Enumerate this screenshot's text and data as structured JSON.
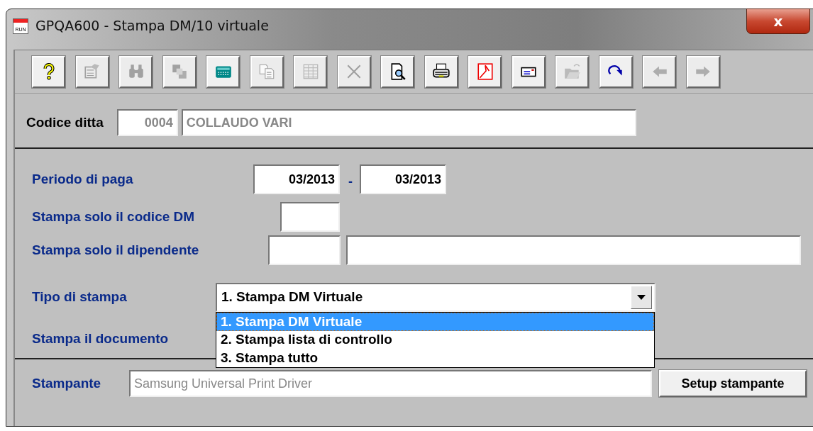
{
  "window": {
    "title": "GPQA600 - Stampa DM/10 virtuale",
    "app_icon_text": "RUN",
    "close": "x"
  },
  "toolbar": [
    {
      "kind": "help",
      "disabled": false
    },
    {
      "kind": "properties",
      "disabled": true
    },
    {
      "kind": "binoculars",
      "disabled": true
    },
    {
      "kind": "squares",
      "disabled": true
    },
    {
      "kind": "calculator",
      "disabled": false
    },
    {
      "kind": "copy",
      "disabled": true
    },
    {
      "kind": "grid",
      "disabled": true
    },
    {
      "kind": "delete",
      "disabled": true
    },
    {
      "kind": "preview",
      "disabled": false
    },
    {
      "kind": "print",
      "disabled": false
    },
    {
      "kind": "pdf",
      "disabled": false
    },
    {
      "kind": "mail",
      "disabled": false
    },
    {
      "kind": "folder",
      "disabled": true
    },
    {
      "kind": "redo",
      "disabled": false
    },
    {
      "kind": "left",
      "disabled": true
    },
    {
      "kind": "right",
      "disabled": true
    }
  ],
  "company": {
    "label": "Codice ditta",
    "code": "0004",
    "name": "COLLAUDO VARI",
    "disabled": true
  },
  "form": {
    "period": {
      "label": "Periodo di paga",
      "from": "03/2013",
      "separator": "-",
      "to": "03/2013"
    },
    "dm_code": {
      "label": "Stampa solo il codice DM"
    },
    "employee": {
      "label": "Stampa solo il dipendente"
    },
    "print_type": {
      "label": "Tipo di stampa",
      "value": "1. Stampa DM Virtuale",
      "expanded": true,
      "options": [
        {
          "label": "1. Stampa DM Virtuale",
          "selected": true
        },
        {
          "label": "2. Stampa lista di controllo",
          "selected": false
        },
        {
          "label": "3. Stampa tutto",
          "selected": false
        }
      ]
    },
    "document": {
      "label": "Stampa il documento"
    }
  },
  "printer": {
    "label": "Stampante",
    "value": "Samsung Universal Print Driver",
    "disabled": true,
    "button": "Setup stampante"
  }
}
